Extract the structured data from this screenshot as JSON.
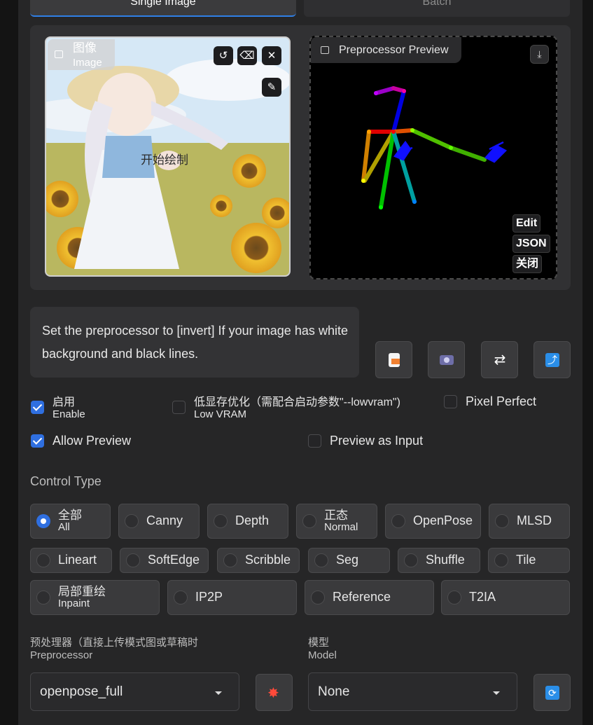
{
  "tabs": {
    "single": "Single Image",
    "batch": "Batch"
  },
  "image_input": {
    "label_cn": "图像",
    "label_en": "Image",
    "overlay_text": "开始绘制",
    "tools": [
      "undo-icon",
      "eraser-icon",
      "close-icon",
      "brush-icon"
    ]
  },
  "preview": {
    "label": "Preprocessor Preview",
    "buttons": {
      "edit": "Edit",
      "json": "JSON",
      "close": "关闭"
    },
    "download_icon": "download-icon"
  },
  "tip": {
    "text": "Set the preprocessor to [invert] If your image has white background and black lines."
  },
  "action_icons": [
    "document-edit-icon",
    "camera-icon",
    "swap-icon",
    "send-dimensions-icon"
  ],
  "options": {
    "enable": {
      "cn": "启用",
      "en": "Enable",
      "checked": true
    },
    "low_vram": {
      "cn": "低显存优化（需配合启动参数\"--lowvram\")",
      "en": "Low VRAM",
      "checked": false
    },
    "pixel_perfect": {
      "label": "Pixel Perfect",
      "checked": false
    },
    "allow_preview": {
      "label": "Allow Preview",
      "checked": true
    },
    "preview_as_input": {
      "label": "Preview as Input",
      "checked": false
    }
  },
  "control_type": {
    "title": "Control Type",
    "selected": "All",
    "row1": [
      {
        "cn": "全部",
        "en": "All"
      },
      {
        "label": "Canny"
      },
      {
        "label": "Depth"
      },
      {
        "cn": "正态",
        "en": "Normal"
      },
      {
        "label": "OpenPose"
      },
      {
        "label": "MLSD"
      }
    ],
    "row2": [
      "Lineart",
      "SoftEdge",
      "Scribble",
      "Seg",
      "Shuffle",
      "Tile"
    ],
    "row3": [
      {
        "cn": "局部重绘",
        "en": "Inpaint"
      },
      {
        "label": "IP2P"
      },
      {
        "label": "Reference"
      },
      {
        "label": "T2IA"
      }
    ]
  },
  "preprocessor": {
    "label_cn": "预处理器（直接上传模式图或草稿时",
    "label_en": "Preprocessor",
    "value": "openpose_full",
    "run_icon": "explosion-icon"
  },
  "model": {
    "label_cn": "模型",
    "label_en": "Model",
    "value": "None",
    "refresh_icon": "refresh-icon"
  },
  "colors": {
    "accent": "#2f6fe0",
    "panel": "#262627",
    "button": "#3a3a3c"
  }
}
